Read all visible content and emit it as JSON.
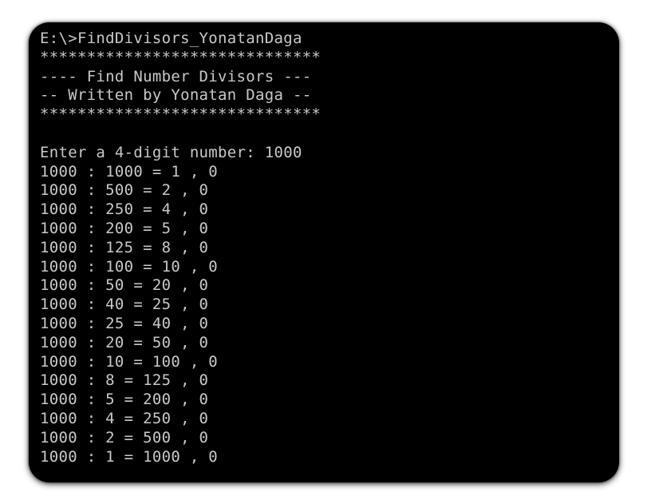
{
  "console": {
    "lines": [
      "E:\\>FindDivisors_YonatanDaga",
      "******************************",
      "---- Find Number Divisors ---",
      "-- Written by Yonatan Daga --",
      "******************************",
      "",
      "Enter a 4-digit number: 1000",
      "1000 : 1000 = 1 , 0",
      "1000 : 500 = 2 , 0",
      "1000 : 250 = 4 , 0",
      "1000 : 200 = 5 , 0",
      "1000 : 125 = 8 , 0",
      "1000 : 100 = 10 , 0",
      "1000 : 50 = 20 , 0",
      "1000 : 40 = 25 , 0",
      "1000 : 25 = 40 , 0",
      "1000 : 20 = 50 , 0",
      "1000 : 10 = 100 , 0",
      "1000 : 8 = 125 , 0",
      "1000 : 5 = 200 , 0",
      "1000 : 4 = 250 , 0",
      "1000 : 2 = 500 , 0",
      "1000 : 1 = 1000 , 0"
    ]
  },
  "colors": {
    "background": "#000000",
    "text": "#c8c8c8"
  }
}
